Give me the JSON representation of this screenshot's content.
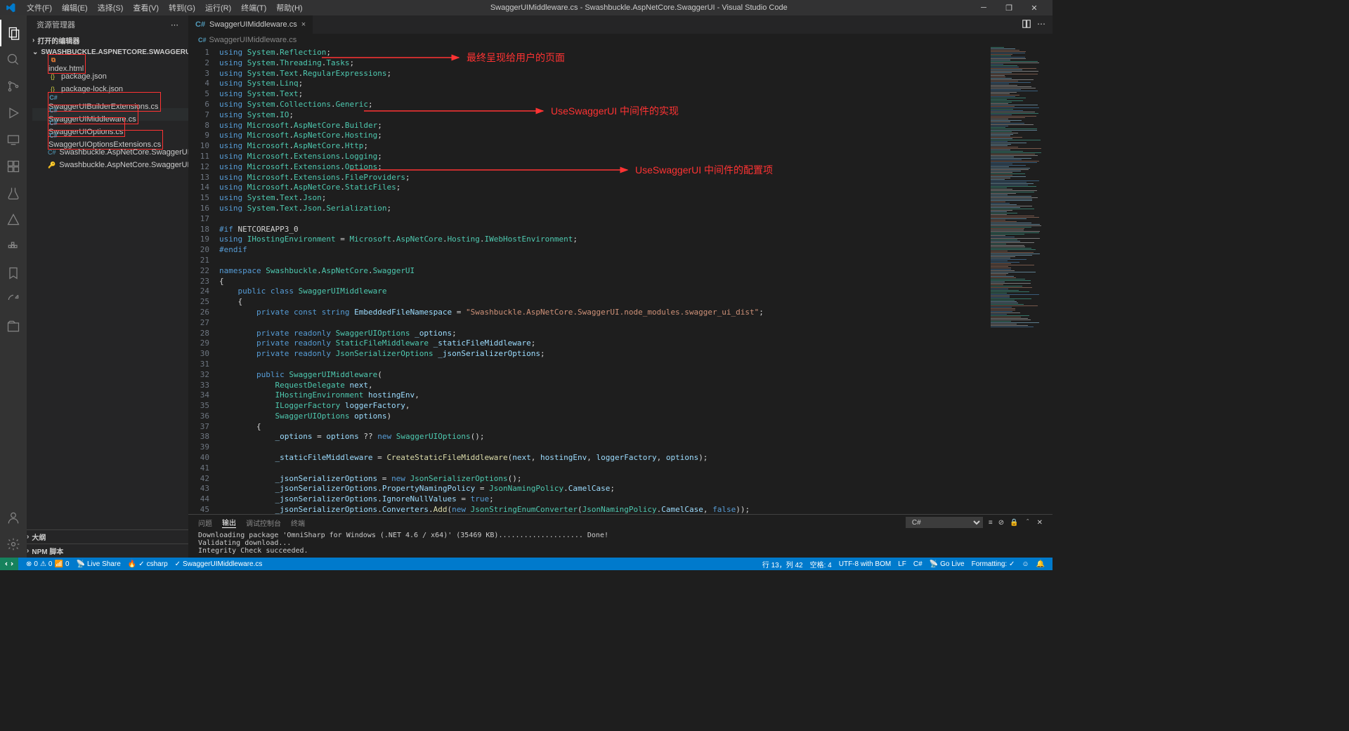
{
  "titlebar": {
    "title": "SwaggerUIMiddleware.cs - Swashbuckle.AspNetCore.SwaggerUI - Visual Studio Code",
    "menu": [
      "文件(F)",
      "编辑(E)",
      "选择(S)",
      "查看(V)",
      "转到(G)",
      "运行(R)",
      "终端(T)",
      "帮助(H)"
    ]
  },
  "sidebar": {
    "title": "资源管理器",
    "openEditors": "打开的编辑器",
    "project": "SWASHBUCKLE.ASPNETCORE.SWAGGERUI",
    "files": [
      {
        "name": "index.html",
        "icon": "html",
        "boxed": true
      },
      {
        "name": "package.json",
        "icon": "json"
      },
      {
        "name": "package-lock.json",
        "icon": "json"
      },
      {
        "name": "SwaggerUIBuilderExtensions.cs",
        "icon": "cs",
        "boxed": true
      },
      {
        "name": "SwaggerUIMiddleware.cs",
        "icon": "cs",
        "boxed": true,
        "selected": true
      },
      {
        "name": "SwaggerUIOptions.cs",
        "icon": "cs",
        "boxed": true
      },
      {
        "name": "SwaggerUIOptionsExtensions.cs",
        "icon": "cs",
        "boxed": true
      },
      {
        "name": "Swashbuckle.AspNetCore.SwaggerUI.csp...",
        "icon": "csproj"
      },
      {
        "name": "Swashbuckle.AspNetCore.SwaggerUI.snk",
        "icon": "key"
      }
    ],
    "outline": "大纲",
    "npm": "NPM 脚本"
  },
  "tabs": {
    "active": "SwaggerUIMiddleware.cs"
  },
  "breadcrumb": {
    "file": "SwaggerUIMiddleware.cs"
  },
  "annotations": {
    "a1": "最终呈现给用户的页面",
    "a2": "UseSwaggerUI 中间件的实现",
    "a3": "UseSwaggerUI 中间件的配置项"
  },
  "code": {
    "lines": [
      {
        "n": 1,
        "html": "<span class='kw'>using</span> <span class='type'>System</span>.<span class='type'>Reflection</span>;"
      },
      {
        "n": 2,
        "html": "<span class='kw'>using</span> <span class='type'>System</span>.<span class='type'>Threading</span>.<span class='type'>Tasks</span>;"
      },
      {
        "n": 3,
        "html": "<span class='kw'>using</span> <span class='type'>System</span>.<span class='type'>Text</span>.<span class='type'>RegularExpressions</span>;"
      },
      {
        "n": 4,
        "html": "<span class='kw'>using</span> <span class='type'>System</span>.<span class='type'>Linq</span>;"
      },
      {
        "n": 5,
        "html": "<span class='kw'>using</span> <span class='type'>System</span>.<span class='type'>Text</span>;"
      },
      {
        "n": 6,
        "html": "<span class='kw'>using</span> <span class='type'>System</span>.<span class='type'>Collections</span>.<span class='type'>Generic</span>;"
      },
      {
        "n": 7,
        "html": "<span class='kw'>using</span> <span class='type'>System</span>.<span class='type'>IO</span>;"
      },
      {
        "n": 8,
        "html": "<span class='kw'>using</span> <span class='type'>Microsoft</span>.<span class='type'>AspNetCore</span>.<span class='type'>Builder</span>;"
      },
      {
        "n": 9,
        "html": "<span class='kw'>using</span> <span class='type'>Microsoft</span>.<span class='type'>AspNetCore</span>.<span class='type'>Hosting</span>;"
      },
      {
        "n": 10,
        "html": "<span class='kw'>using</span> <span class='type'>Microsoft</span>.<span class='type'>AspNetCore</span>.<span class='type'>Http</span>;"
      },
      {
        "n": 11,
        "html": "<span class='kw'>using</span> <span class='type'>Microsoft</span>.<span class='type'>Extensions</span>.<span class='type'>Logging</span>;"
      },
      {
        "n": 12,
        "html": "<span class='kw'>using</span> <span class='type'>Microsoft</span>.<span class='type'>Extensions</span>.<span class='type'>Options</span>;"
      },
      {
        "n": 13,
        "html": "<span class='kw'>using</span> <span class='type'>Microsoft</span>.<span class='type'>Extensions</span>.<span class='type'>FileProviders</span>;"
      },
      {
        "n": 14,
        "html": "<span class='kw'>using</span> <span class='type'>Microsoft</span>.<span class='type'>AspNetCore</span>.<span class='type'>StaticFiles</span>;"
      },
      {
        "n": 15,
        "html": "<span class='kw'>using</span> <span class='type'>System</span>.<span class='type'>Text</span>.<span class='type'>Json</span>;"
      },
      {
        "n": 16,
        "html": "<span class='kw'>using</span> <span class='type'>System</span>.<span class='type'>Text</span>.<span class='type'>Json</span>.<span class='type'>Serialization</span>;"
      },
      {
        "n": 17,
        "html": ""
      },
      {
        "n": 18,
        "html": "<span class='kw'>#if</span> NETCOREAPP3_0"
      },
      {
        "n": 19,
        "html": "<span class='kw'>using</span> <span class='type'>IHostingEnvironment</span> = <span class='type'>Microsoft</span>.<span class='type'>AspNetCore</span>.<span class='type'>Hosting</span>.<span class='type'>IWebHostEnvironment</span>;"
      },
      {
        "n": 20,
        "html": "<span class='kw'>#endif</span>"
      },
      {
        "n": 21,
        "html": ""
      },
      {
        "n": 22,
        "html": "<span class='kw'>namespace</span> <span class='type'>Swashbuckle</span>.<span class='type'>AspNetCore</span>.<span class='type'>SwaggerUI</span>"
      },
      {
        "n": 23,
        "html": "{"
      },
      {
        "n": 24,
        "html": "    <span class='kw'>public</span> <span class='kw'>class</span> <span class='type'>SwaggerUIMiddleware</span>"
      },
      {
        "n": 25,
        "html": "    {"
      },
      {
        "n": 26,
        "html": "        <span class='kw'>private</span> <span class='kw'>const</span> <span class='kw'>string</span> <span class='field'>EmbeddedFileNamespace</span> = <span class='str'>\"Swashbuckle.AspNetCore.SwaggerUI.node_modules.swagger_ui_dist\"</span>;"
      },
      {
        "n": 27,
        "html": ""
      },
      {
        "n": 28,
        "html": "        <span class='kw'>private</span> <span class='kw'>readonly</span> <span class='type'>SwaggerUIOptions</span> <span class='field'>_options</span>;"
      },
      {
        "n": 29,
        "html": "        <span class='kw'>private</span> <span class='kw'>readonly</span> <span class='type'>StaticFileMiddleware</span> <span class='field'>_staticFileMiddleware</span>;"
      },
      {
        "n": 30,
        "html": "        <span class='kw'>private</span> <span class='kw'>readonly</span> <span class='type'>JsonSerializerOptions</span> <span class='field'>_jsonSerializerOptions</span>;"
      },
      {
        "n": 31,
        "html": ""
      },
      {
        "n": 32,
        "html": "        <span class='kw'>public</span> <span class='type'>SwaggerUIMiddleware</span>("
      },
      {
        "n": 33,
        "html": "            <span class='type'>RequestDelegate</span> <span class='field'>next</span>,"
      },
      {
        "n": 34,
        "html": "            <span class='type'>IHostingEnvironment</span> <span class='field'>hostingEnv</span>,"
      },
      {
        "n": 35,
        "html": "            <span class='type'>ILoggerFactory</span> <span class='field'>loggerFactory</span>,"
      },
      {
        "n": 36,
        "html": "            <span class='type'>SwaggerUIOptions</span> <span class='field'>options</span>)"
      },
      {
        "n": 37,
        "html": "        {"
      },
      {
        "n": 38,
        "html": "            <span class='field'>_options</span> = <span class='field'>options</span> ?? <span class='kw'>new</span> <span class='type'>SwaggerUIOptions</span>();"
      },
      {
        "n": 39,
        "html": ""
      },
      {
        "n": 40,
        "html": "            <span class='field'>_staticFileMiddleware</span> = <span class='func'>CreateStaticFileMiddleware</span>(<span class='field'>next</span>, <span class='field'>hostingEnv</span>, <span class='field'>loggerFactory</span>, <span class='field'>options</span>);"
      },
      {
        "n": 41,
        "html": ""
      },
      {
        "n": 42,
        "html": "            <span class='field'>_jsonSerializerOptions</span> = <span class='kw'>new</span> <span class='type'>JsonSerializerOptions</span>();"
      },
      {
        "n": 43,
        "html": "            <span class='field'>_jsonSerializerOptions</span>.<span class='field'>PropertyNamingPolicy</span> = <span class='type'>JsonNamingPolicy</span>.<span class='field'>CamelCase</span>;"
      },
      {
        "n": 44,
        "html": "            <span class='field'>_jsonSerializerOptions</span>.<span class='field'>IgnoreNullValues</span> = <span class='kw'>true</span>;"
      },
      {
        "n": 45,
        "html": "            <span class='field'>_jsonSerializerOptions</span>.<span class='field'>Converters</span>.<span class='func'>Add</span>(<span class='kw'>new</span> <span class='type'>JsonStringEnumConverter</span>(<span class='type'>JsonNamingPolicy</span>.<span class='field'>CamelCase</span>, <span class='kw'>false</span>));"
      }
    ]
  },
  "panel": {
    "tabs": [
      "问题",
      "输出",
      "调试控制台",
      "终端"
    ],
    "activeTab": 1,
    "dropdown": "C#",
    "output": "Downloading package 'OmniSharp for Windows (.NET 4.6 / x64)' (35469 KB).................... Done!\nValidating download...\nIntegrity Check succeeded."
  },
  "statusbar": {
    "left": {
      "errors": "0",
      "warnings": "0",
      "signal": "0",
      "liveShare": "Live Share",
      "flame": "csharp",
      "file": "SwaggerUIMiddleware.cs"
    },
    "right": {
      "position": "行 13，列 42",
      "spaces": "空格: 4",
      "encoding": "UTF-8 with BOM",
      "eol": "LF",
      "lang": "C#",
      "golive": "Go Live",
      "formatting": "Formatting: ✓",
      "bell": "🔔"
    }
  }
}
